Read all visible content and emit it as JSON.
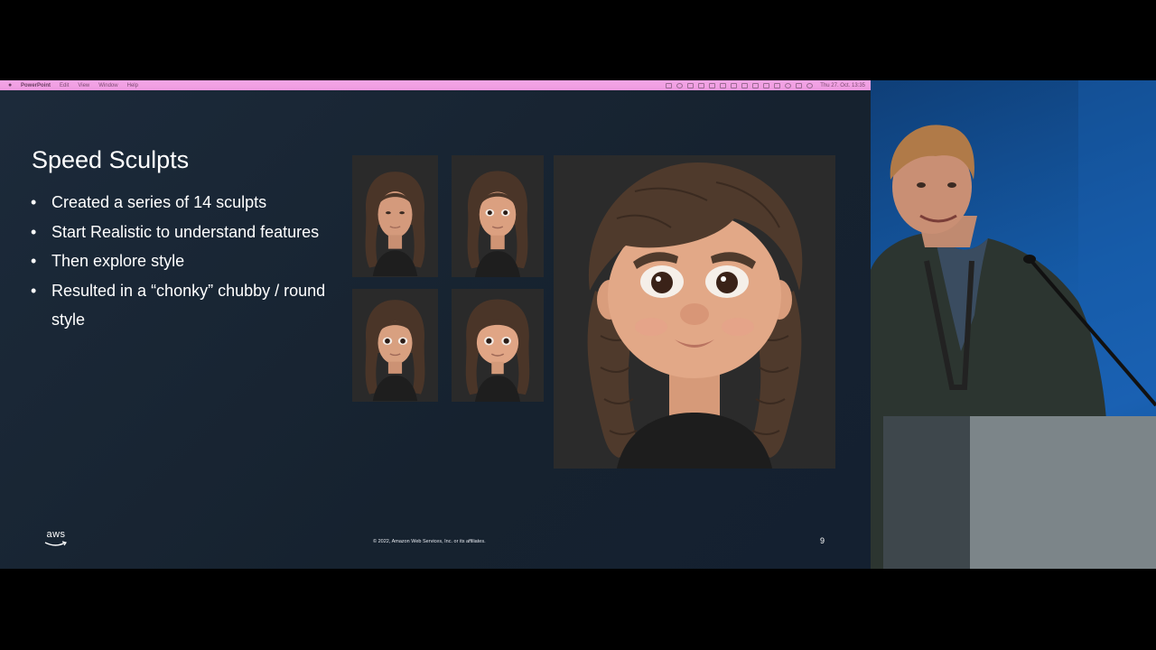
{
  "menubar": {
    "apple_symbol": "",
    "items": [
      "PowerPoint",
      "Edit",
      "View",
      "Window",
      "Help"
    ],
    "clock": "Thu 27. Oct. 13:35"
  },
  "slide": {
    "title": "Speed Sculpts",
    "bullets": [
      "Created a series of 14 sculpts",
      "Start Realistic to understand features",
      "Then explore style",
      "Resulted in a “chonky” chubby / round style"
    ],
    "logo_text": "aws",
    "copyright": "© 2022, Amazon Web Services, Inc. or its affiliates.",
    "page_number": "9"
  },
  "colors": {
    "menubar": "#f1a0e3",
    "slide_bg": "#1a2736",
    "hair": "#4a3528",
    "skin": "#e0a585",
    "stage_blue": "#1560b0"
  }
}
